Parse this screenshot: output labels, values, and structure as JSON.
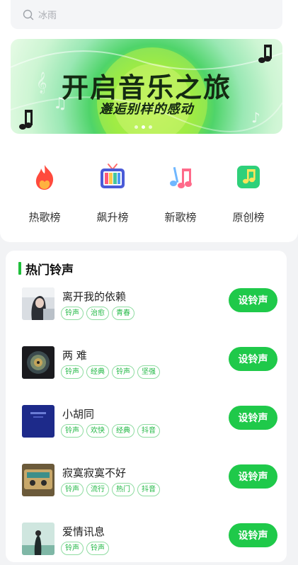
{
  "search": {
    "placeholder": "冰雨"
  },
  "banner": {
    "title": "开启音乐之旅",
    "subtitle": "邂逅别样的感动",
    "dots": 3,
    "active_dot": 1
  },
  "categories": [
    {
      "label": "热歌榜",
      "icon": "fire-icon"
    },
    {
      "label": "飙升榜",
      "icon": "tv-icon"
    },
    {
      "label": "新歌榜",
      "icon": "music-note-icon"
    },
    {
      "label": "原创榜",
      "icon": "music-card-icon"
    }
  ],
  "hot_ringtones": {
    "title": "热门铃声",
    "button_label": "设铃声",
    "items": [
      {
        "name": "离开我的依赖",
        "tags": [
          "铃声",
          "治愈",
          "青春"
        ]
      },
      {
        "name": "两 难",
        "tags": [
          "铃声",
          "经典",
          "铃声",
          "坚强"
        ]
      },
      {
        "name": "小胡同",
        "tags": [
          "铃声",
          "欢快",
          "经典",
          "抖音"
        ]
      },
      {
        "name": "寂寞寂寞不好",
        "tags": [
          "铃声",
          "流行",
          "热门",
          "抖音"
        ]
      },
      {
        "name": "爱情讯息",
        "tags": [
          "铃声",
          "铃声"
        ]
      }
    ]
  },
  "colors": {
    "accent": "#1fc94a",
    "tag_text": "#22b845"
  }
}
